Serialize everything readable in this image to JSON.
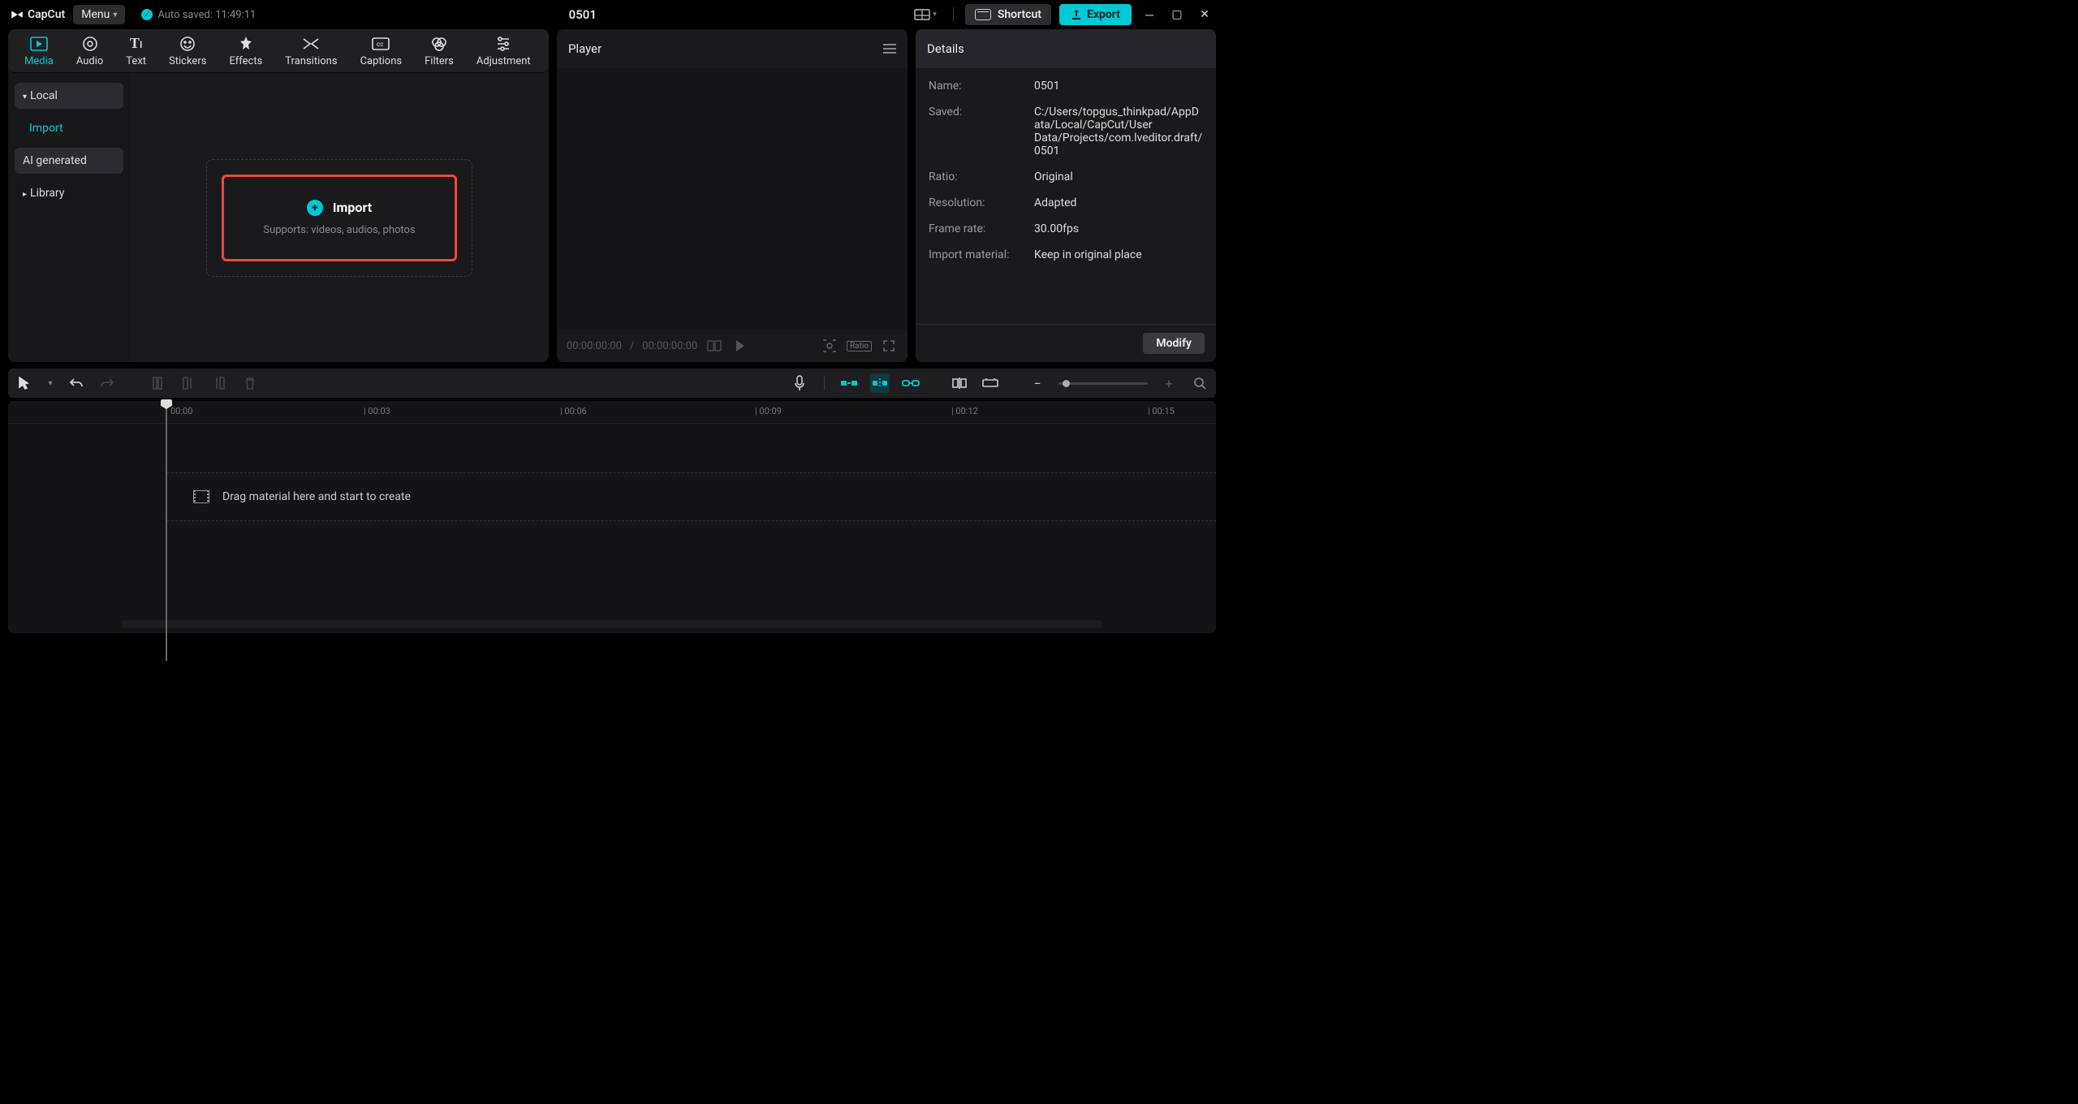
{
  "titlebar": {
    "app_name": "CapCut",
    "menu_label": "Menu",
    "autosave": "Auto saved: 11:49:11",
    "project_title": "0501",
    "shortcut_label": "Shortcut",
    "export_label": "Export"
  },
  "top_tabs": {
    "media": "Media",
    "audio": "Audio",
    "text": "Text",
    "stickers": "Stickers",
    "effects": "Effects",
    "transitions": "Transitions",
    "captions": "Captions",
    "filters": "Filters",
    "adjustment": "Adjustment"
  },
  "media_sidebar": {
    "local": "Local",
    "import": "Import",
    "ai_generated": "AI generated",
    "library": "Library"
  },
  "import_box": {
    "title": "Import",
    "subtitle": "Supports: videos, audios, photos"
  },
  "player": {
    "title": "Player",
    "time_current": "00:00:00:00",
    "time_sep": "/",
    "time_total": "00:00:00:00",
    "ratio_label": "Ratio"
  },
  "details": {
    "title": "Details",
    "rows": {
      "name_k": "Name:",
      "name_v": "0501",
      "saved_k": "Saved:",
      "saved_v": "C:/Users/topgus_thinkpad/AppData/Local/CapCut/User Data/Projects/com.lveditor.draft/0501",
      "ratio_k": "Ratio:",
      "ratio_v": "Original",
      "resolution_k": "Resolution:",
      "resolution_v": "Adapted",
      "framerate_k": "Frame rate:",
      "framerate_v": "30.00fps",
      "import_k": "Import material:",
      "import_v": "Keep in original place"
    },
    "modify": "Modify"
  },
  "timeline": {
    "ticks": [
      "00:00",
      "00:03",
      "00:06",
      "00:09",
      "00:12",
      "00:15"
    ],
    "drag_hint": "Drag material here and start to create"
  }
}
